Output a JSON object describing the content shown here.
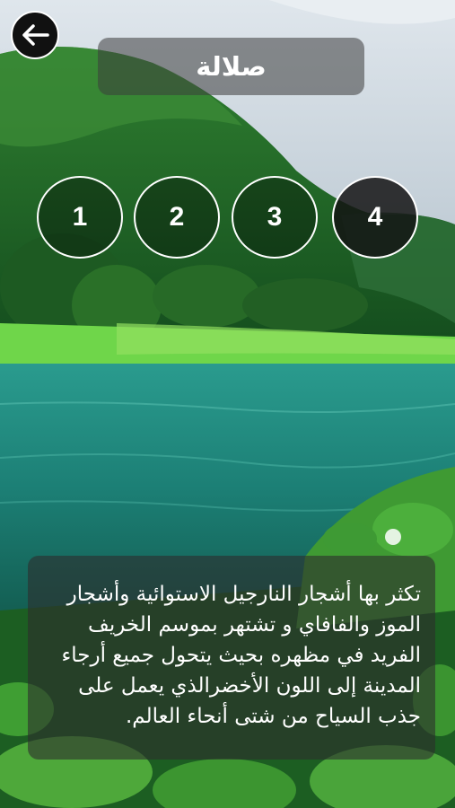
{
  "header": {
    "back_icon": "arrow-left-icon",
    "title": "صلالة"
  },
  "pager": {
    "items": [
      {
        "label": "1"
      },
      {
        "label": "2"
      },
      {
        "label": "3"
      },
      {
        "label": "4"
      }
    ],
    "active_index": 3
  },
  "content": {
    "description": "تكثر بها أشجار النارجيل الاستوائية وأشجار الموز والفافاي و تشتهر بموسم الخريف الفريد في مظهره بحيث يتحول جميع أرجاء المدينة إلى اللون الأخضرالذي يعمل على جذب السياح من شتى أنحاء العالم."
  },
  "colors": {
    "sky": "#cfd8e0",
    "hill": "#1f6b2a",
    "water": "#1f8f80",
    "grass": "#5fcf3a",
    "overlay": "#2d2d2d"
  }
}
